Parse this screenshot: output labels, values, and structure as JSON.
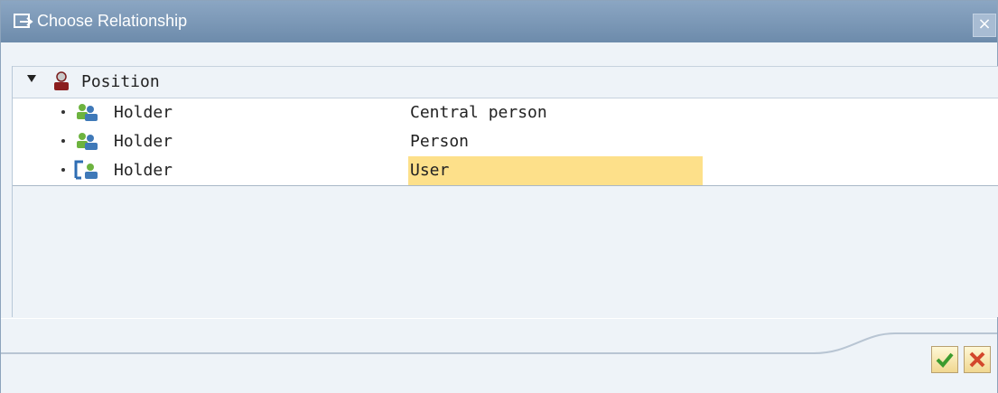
{
  "window": {
    "title": "Choose Relationship"
  },
  "tree": {
    "root": {
      "label": "Position",
      "icon": "person-position-icon"
    },
    "rows": [
      {
        "label": "Holder",
        "relation": "Central person",
        "icon": "person-group-icon"
      },
      {
        "label": "Holder",
        "relation": "Person",
        "icon": "person-group-icon"
      },
      {
        "label": "Holder",
        "relation": "User",
        "icon": "user-icon",
        "selected": true
      }
    ]
  },
  "buttons": {
    "ok": "confirm-icon",
    "cancel": "cancel-icon"
  },
  "colors": {
    "selection": "#fde08a",
    "title_bar": "#7d99b8"
  }
}
